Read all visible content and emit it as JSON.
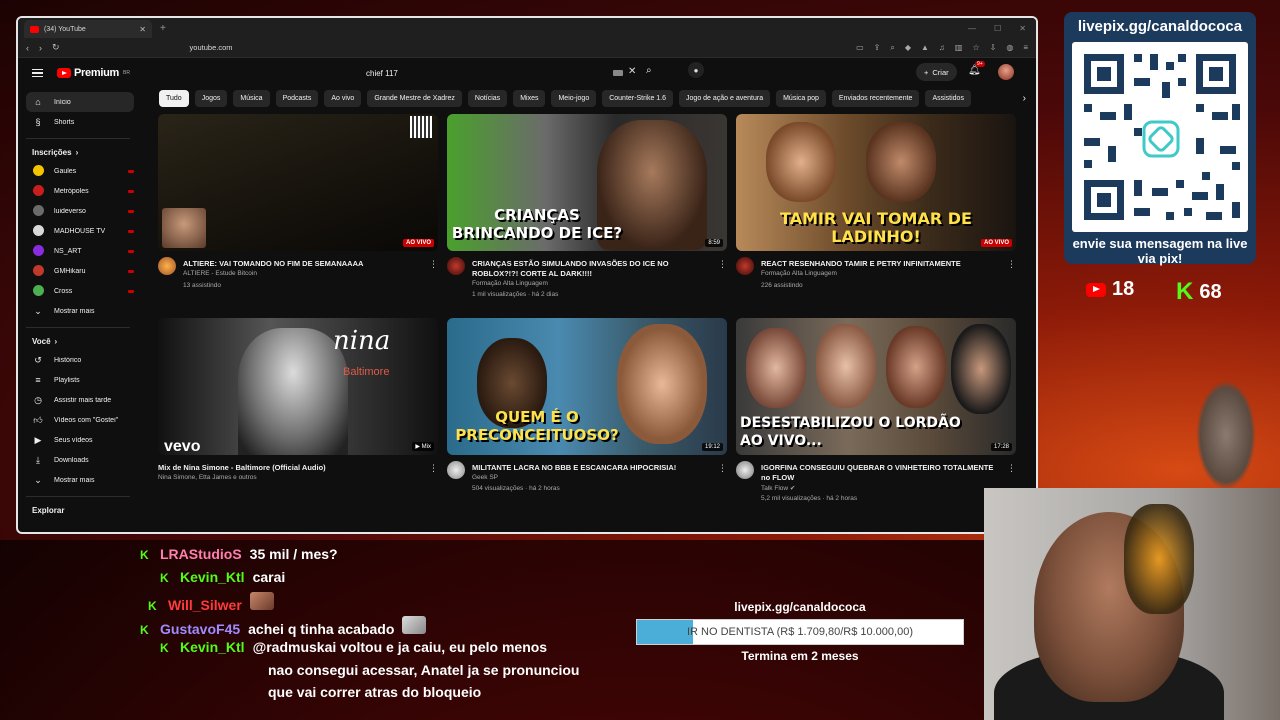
{
  "browser": {
    "tab_title": "(34) YouTube",
    "url": "youtube.com"
  },
  "youtube": {
    "logo_text": "Premium",
    "logo_sup": "BR",
    "search_query": "chief 117",
    "create_label": "Criar",
    "notifications": "9+",
    "sidebar": {
      "main": [
        {
          "label": "Início",
          "icon": "home-icon"
        },
        {
          "label": "Shorts",
          "icon": "shorts-icon"
        }
      ],
      "subs_title": "Inscrições",
      "subs": [
        {
          "label": "Gaules",
          "color": "#f5c400"
        },
        {
          "label": "Metrópoles",
          "color": "#c81e1e"
        },
        {
          "label": "luideverso",
          "color": "#6b6b6b"
        },
        {
          "label": "MADHOUSE TV",
          "color": "#d9d9d9"
        },
        {
          "label": "NS_ART",
          "color": "#8a2be2"
        },
        {
          "label": "GMHikaru",
          "color": "#c0392b"
        },
        {
          "label": "Cross",
          "color": "#4caf50"
        }
      ],
      "show_more": "Mostrar mais",
      "you_title": "Você",
      "you": [
        {
          "label": "Histórico",
          "icon": "history-icon"
        },
        {
          "label": "Playlists",
          "icon": "playlist-icon"
        },
        {
          "label": "Assistir mais tarde",
          "icon": "clock-icon"
        },
        {
          "label": "Vídeos com \"Gostei\"",
          "icon": "like-icon"
        },
        {
          "label": "Seus vídeos",
          "icon": "video-icon"
        },
        {
          "label": "Downloads",
          "icon": "download-icon"
        }
      ],
      "show_more2": "Mostrar mais",
      "explore_title": "Explorar"
    },
    "chips": [
      "Tudo",
      "Jogos",
      "Música",
      "Podcasts",
      "Ao vivo",
      "Grande Mestre de Xadrez",
      "Notícias",
      "Mixes",
      "Meio-jogo",
      "Counter-Strike 1.6",
      "Jogo de ação e aventura",
      "Música pop",
      "Enviados recentemente",
      "Assistidos"
    ],
    "videos": [
      {
        "title": "ALTIERE: VAI TOMANDO NO FIM DE SEMANAAAA",
        "channel": "ALTIERE - Estude Bitcoin",
        "stats": "13 assistindo",
        "badge": "AO VIVO",
        "thumb_text": ""
      },
      {
        "title": "CRIANÇAS ESTÃO SIMULANDO INVASÕES DO ICE NO ROBLOX?!?! CORTE AL DARK!!!!",
        "channel": "Formação Alta Linguagem",
        "stats": "1 mil visualizações · há 2 dias",
        "badge": "8:59",
        "thumb_text": "CRIANÇAS BRINCANDO DE ICE?"
      },
      {
        "title": "REACT RESENHANDO TAMIR E PETRY INFINITAMENTE",
        "channel": "Formação Alta Linguagem",
        "stats": "226 assistindo",
        "badge": "AO VIVO",
        "thumb_text": "TAMIR VAI TOMAR DE LADINHO!"
      },
      {
        "title": "Mix de Nina Simone - Baltimore (Official Audio)",
        "channel": "Nina Simone, Etta James e outros",
        "stats": "",
        "badge": "Mix",
        "thumb_text": "nina"
      },
      {
        "title": "MILITANTE LACRA NO BBB E ESCANCARA HIPOCRISIA!",
        "channel": "Geek SP",
        "stats": "504 visualizações · há 2 horas",
        "badge": "19:12",
        "thumb_text": "QUEM É O PRECONCEITUOSO?"
      },
      {
        "title": "IGORFINA CONSEGUIU QUEBRAR O VINHETEIRO TOTALMENTE no FLOW",
        "channel": "Talk Flow",
        "stats": "5,2 mil visualizações · há 2 horas",
        "badge": "17:28",
        "thumb_text": "DESESTABILIZOU O LORDÃO AO VIVO..."
      }
    ],
    "nina_sub": "Baltimore",
    "vevo": "vevo"
  },
  "overlay": {
    "qr_url": "livepix.gg/canaldococa",
    "qr_message": "envie sua mensagem na live via pix!",
    "yt_viewers": "18",
    "kick_viewers": "68",
    "chat": [
      {
        "user": "LRAStudioS",
        "color": "#ff7fb0",
        "text": "35 mil / mes?"
      },
      {
        "user": "Kevin_Ktl",
        "color": "#53fc18",
        "text": "carai"
      },
      {
        "user": "Will_Silwer",
        "color": "#ff3b3b",
        "text": ""
      },
      {
        "user": "GustavoF45",
        "color": "#9f8cff",
        "text": "achei q tinha acabado"
      },
      {
        "user": "Kevin_Ktl",
        "color": "#53fc18",
        "text": "@radmuskai voltou e ja caiu, eu pelo menos"
      },
      {
        "user": "",
        "color": "#ffffff",
        "text": "nao consegui acessar, Anatel ja se pronunciou"
      },
      {
        "user": "",
        "color": "#ffffff",
        "text": "que vai correr atras do bloqueio"
      }
    ],
    "goal": {
      "site": "livepix.gg/canaldococa",
      "text": "IR NO DENTISTA (R$ 1.709,80/R$ 10.000,00)",
      "progress": 0.171,
      "ends": "Termina em 2 meses"
    }
  }
}
